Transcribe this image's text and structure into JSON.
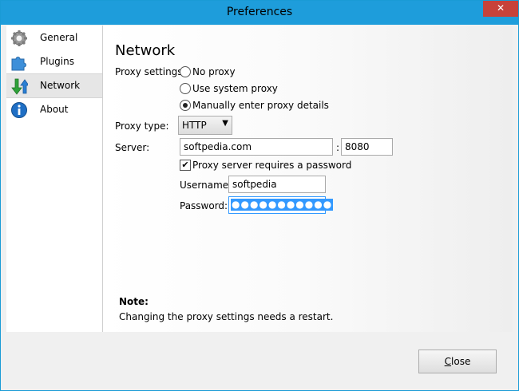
{
  "window": {
    "title": "Preferences",
    "close_glyph": "✕"
  },
  "sidebar": {
    "items": [
      {
        "label": "General",
        "icon": "gear-icon"
      },
      {
        "label": "Plugins",
        "icon": "puzzle-icon"
      },
      {
        "label": "Network",
        "icon": "network-arrows-icon",
        "selected": true
      },
      {
        "label": "About",
        "icon": "info-icon"
      }
    ]
  },
  "network": {
    "heading": "Network",
    "proxy_settings_label": "Proxy settings:",
    "options": [
      {
        "label": "No proxy",
        "checked": false
      },
      {
        "label": "Use system proxy",
        "checked": false
      },
      {
        "label": "Manually enter proxy details",
        "checked": true
      }
    ],
    "proxy_type_label": "Proxy type:",
    "proxy_type_value": "HTTP",
    "server_label": "Server:",
    "server_value": "softpedia.com",
    "port_separator": ":",
    "port_value": "8080",
    "requires_password_label": "Proxy server requires a password",
    "requires_password_checked": true,
    "username_label": "Username:",
    "username_value": "softpedia",
    "password_label": "Password:",
    "password_masked": "●●●●●●●●●●●"
  },
  "note": {
    "title": "Note:",
    "text": "Changing the proxy settings needs a restart."
  },
  "footer": {
    "close_label_underlined": "C",
    "close_label_rest": "lose"
  }
}
